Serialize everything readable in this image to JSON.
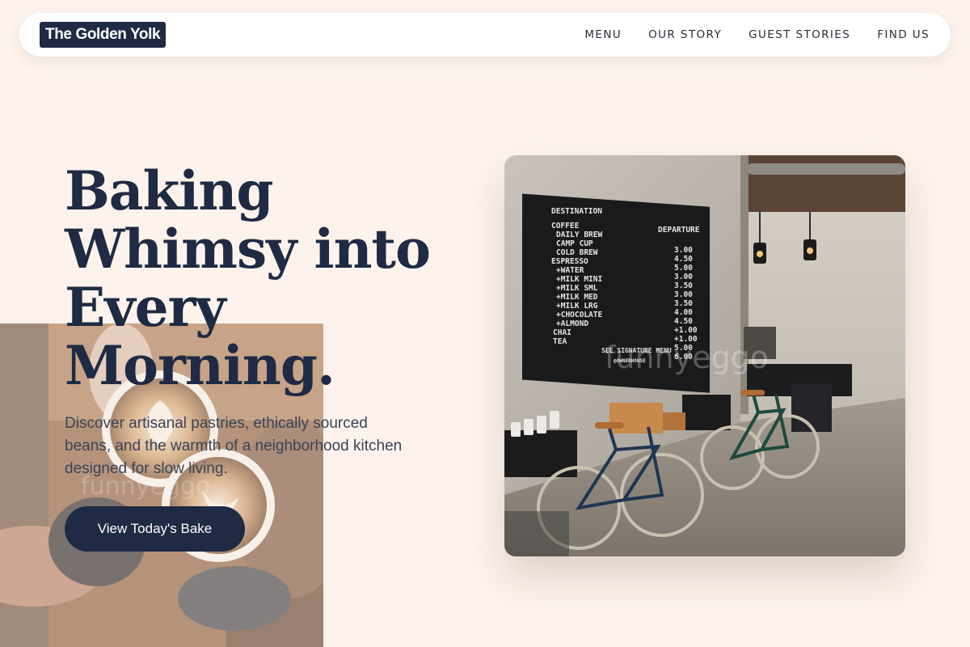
{
  "navbar": {
    "brand": "The Golden Yolk",
    "links": [
      "MENU",
      "OUR STORY",
      "GUEST STORIES",
      "FIND US"
    ]
  },
  "hero": {
    "title": "Baking Whimsy into Every Morning.",
    "subtitle": "Discover artisanal pastries, ethically sourced beans, and the warmth of a neighborhood kitchen designed for slow living.",
    "cta_label": "View Today's Bake"
  },
  "board": {
    "header_left": "DESTINATION",
    "header_right": "DEPARTURE",
    "items": [
      "COFFEE",
      "DAILY BREW",
      "CAMP CUP",
      "COLD BREW",
      "ESPRESSO",
      "+WATER",
      "+MILK MINI",
      "+MILK SML",
      "+MILK MED",
      "+MILK LRG",
      "+CHOCOLATE",
      "+ALMOND",
      "CHAI",
      "TEA"
    ],
    "prices": [
      "3.00",
      "4.50",
      "5.00",
      "3.00",
      "3.50",
      "3.00",
      "3.50",
      "4.00",
      "4.50",
      "+1.00",
      "+1.00",
      "5.00",
      "6.00"
    ],
    "footer": "SEE SIGNATURE MENU",
    "footer_sub": "@OWNERHOUSE"
  },
  "watermark": "funnyeggo",
  "colors": {
    "background": "#fdf3ec",
    "navy": "#1f2a44",
    "nav_bg": "#ffffff"
  }
}
